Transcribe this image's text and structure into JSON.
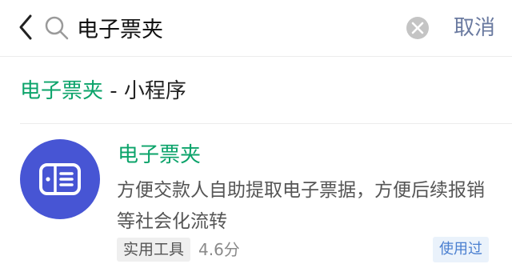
{
  "search": {
    "query": "电子票夹",
    "cancel_label": "取消"
  },
  "section": {
    "highlight": "电子票夹",
    "suffix": " - 小程序"
  },
  "result": {
    "name": "电子票夹",
    "description": "方便交款人自助提取电子票据，方便后续报销等社会化流转",
    "tag": "实用工具",
    "rating": "4.6分",
    "badge": "使用过",
    "logo_color": "#4755d4"
  },
  "colors": {
    "accent_green": "#0ba36a",
    "cancel_blue": "#6a7aa0",
    "badge_blue": "#4a7fd0"
  },
  "icons": [
    "back-arrow-icon",
    "search-icon",
    "clear-icon",
    "receipt-folder-icon"
  ]
}
